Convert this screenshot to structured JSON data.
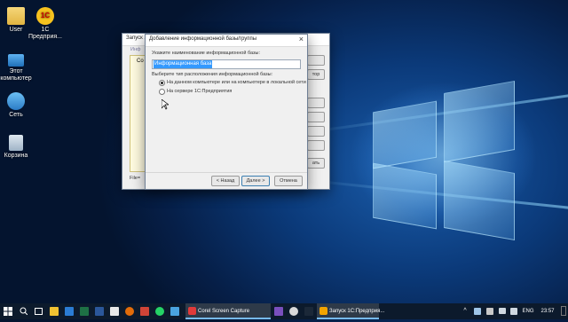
{
  "desktop": {
    "icons": [
      {
        "label": "User",
        "icon": "user-folder-icon"
      },
      {
        "label": "1С\nПредприя...",
        "icon": "1c-app-icon"
      },
      {
        "label": "Этот\nкомпьютер",
        "icon": "computer-icon"
      },
      {
        "label": "Сеть",
        "icon": "network-icon"
      },
      {
        "label": "Корзина",
        "icon": "recycle-bin-icon"
      }
    ]
  },
  "back_window": {
    "title": "Запуск 1С",
    "tab_label": "Инф",
    "list_label": "Со",
    "buttons": [
      "",
      "тор",
      "",
      "",
      "",
      "",
      "",
      "ать",
      ""
    ],
    "file_label": "File="
  },
  "dialog": {
    "title": "Добавление информационной базы/группы",
    "name_prompt": "Укажите наименование информационной базы:",
    "name_value": "Информационная база",
    "location_prompt": "Выберите тип расположения информационной базы:",
    "options": [
      {
        "label": "На данном компьютере или на компьютере в локальной сети",
        "selected": true
      },
      {
        "label": "На сервере 1С:Предприятия",
        "selected": false
      }
    ],
    "back_button": "< Назад",
    "next_button": "Далее >",
    "cancel_button": "Отмена"
  },
  "taskbar": {
    "tasks": [
      {
        "label": "Corel Screen Capture",
        "icon": "corel-icon",
        "color": "#e03a3a"
      },
      {
        "label": "Запуск 1С:Предприя...",
        "icon": "1c-app-icon",
        "color": "#f2a400"
      }
    ],
    "language": "ENG",
    "time": "23:57"
  },
  "colors": {
    "accent": "#76b9ed",
    "taskbar": "#0c1a2c",
    "selection": "#3399ff"
  }
}
